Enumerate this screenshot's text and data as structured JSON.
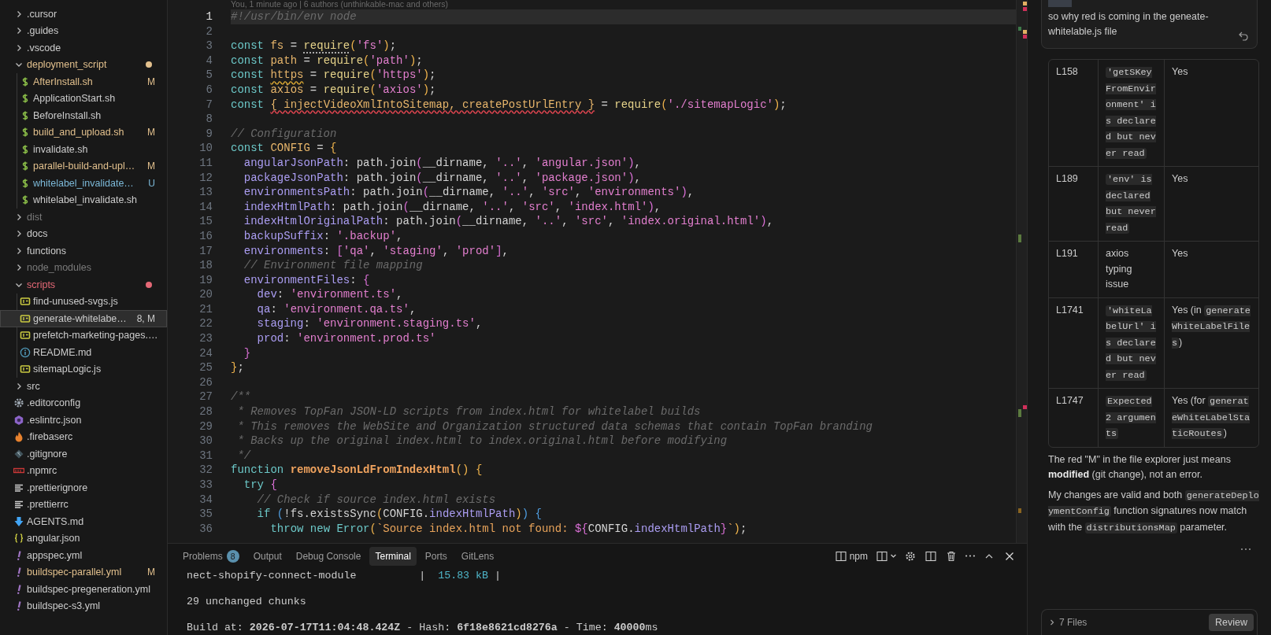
{
  "explorer": {
    "items": [
      {
        "name": ".cursor",
        "kind": "folder",
        "expanded": false,
        "dot": false,
        "color": "#cccccc",
        "selected": false
      },
      {
        "name": ".guides",
        "kind": "folder",
        "expanded": false,
        "dot": false,
        "color": "#cccccc",
        "selected": false
      },
      {
        "name": ".vscode",
        "kind": "folder",
        "expanded": false,
        "dot": false,
        "color": "#cccccc",
        "selected": false
      },
      {
        "name": "deployment_script",
        "kind": "folder",
        "expanded": true,
        "dot": true,
        "color": "#e2c08d",
        "selected": false,
        "children": [
          {
            "name": "AfterInstall.sh",
            "kind": "shell",
            "color": "#e2c08d",
            "badge": "M",
            "selected": false
          },
          {
            "name": "ApplicationStart.sh",
            "kind": "shell",
            "color": "#cccccc",
            "selected": false
          },
          {
            "name": "BeforeInstall.sh",
            "kind": "shell",
            "color": "#cccccc",
            "selected": false
          },
          {
            "name": "build_and_upload.sh",
            "kind": "shell",
            "color": "#e2c08d",
            "badge": "M",
            "selected": false
          },
          {
            "name": "invalidate.sh",
            "kind": "shell",
            "color": "#cccccc",
            "selected": false
          },
          {
            "name": "parallel-build-and-upl…",
            "kind": "shell",
            "color": "#e2c08d",
            "badge": "M",
            "selected": false
          },
          {
            "name": "whitelabel_invalidate…",
            "kind": "shell",
            "color": "#7cb9d8",
            "badge": "U",
            "selected": false
          },
          {
            "name": "whitelabel_invalidate.sh",
            "kind": "shell",
            "color": "#cccccc",
            "selected": false
          }
        ]
      },
      {
        "name": "dist",
        "kind": "folder",
        "expanded": false,
        "dot": false,
        "color": "#7a7a7a",
        "selected": false
      },
      {
        "name": "docs",
        "kind": "folder",
        "expanded": false,
        "dot": false,
        "color": "#cccccc",
        "selected": false
      },
      {
        "name": "functions",
        "kind": "folder",
        "expanded": false,
        "dot": false,
        "color": "#cccccc",
        "selected": false
      },
      {
        "name": "node_modules",
        "kind": "folder",
        "expanded": false,
        "dot": false,
        "color": "#7a7a7a",
        "selected": false
      },
      {
        "name": "scripts",
        "kind": "folder",
        "expanded": true,
        "dot": true,
        "color": "#e46876",
        "selected": false,
        "children": [
          {
            "name": "find-unused-svgs.js",
            "kind": "js",
            "color": "#cccccc",
            "selected": false
          },
          {
            "name": "generate-whitelabe…",
            "kind": "js",
            "color": "#cccccc",
            "badge": "8, M",
            "selected": true
          },
          {
            "name": "prefetch-marketing-pages.…",
            "kind": "js",
            "color": "#cccccc",
            "selected": false
          },
          {
            "name": "README.md",
            "kind": "info",
            "color": "#cccccc",
            "selected": false
          },
          {
            "name": "sitemapLogic.js",
            "kind": "js",
            "color": "#cccccc",
            "selected": false
          }
        ]
      },
      {
        "name": "src",
        "kind": "folder",
        "expanded": false,
        "dot": false,
        "color": "#cccccc",
        "selected": false
      },
      {
        "name": ".editorconfig",
        "kind": "gear",
        "color": "#cccccc",
        "selected": false
      },
      {
        "name": ".eslintrc.json",
        "kind": "hexagon",
        "color": "#cccccc",
        "selected": false
      },
      {
        "name": ".firebaserc",
        "kind": "flame",
        "color": "#cccccc",
        "selected": false
      },
      {
        "name": ".gitignore",
        "kind": "diamond",
        "color": "#cccccc",
        "selected": false
      },
      {
        "name": ".npmrc",
        "kind": "bar",
        "color": "#cccccc",
        "selected": false
      },
      {
        "name": ".prettierignore",
        "kind": "lines",
        "color": "#cccccc",
        "selected": false
      },
      {
        "name": ".prettierrc",
        "kind": "lines",
        "color": "#cccccc",
        "selected": false
      },
      {
        "name": "AGENTS.md",
        "kind": "arrow",
        "color": "#cccccc",
        "selected": false
      },
      {
        "name": "angular.json",
        "kind": "braces",
        "color": "#cccccc",
        "selected": false
      },
      {
        "name": "appspec.yml",
        "kind": "yaml",
        "color": "#cccccc",
        "selected": false
      },
      {
        "name": "buildspec-parallel.yml",
        "kind": "yaml",
        "color": "#e2c08d",
        "badge": "M",
        "selected": false
      },
      {
        "name": "buildspec-pregeneration.yml",
        "kind": "yaml",
        "color": "#cccccc",
        "selected": false
      },
      {
        "name": "buildspec-s3.yml",
        "kind": "yaml",
        "color": "#cccccc",
        "selected": false
      }
    ]
  },
  "editor": {
    "codelens": "You, 1 minute ago | 6 authors (unthinkable-mac and others)",
    "lines": [
      {
        "number": "1",
        "kind": "plain",
        "current": true,
        "text": "#!/usr/bin/env node"
      },
      {
        "number": "2",
        "current": false
      },
      {
        "number": "3",
        "kind": "hint",
        "current": false,
        "text": "const fs = require('fs');"
      },
      {
        "number": "4",
        "kind": "plain",
        "current": false,
        "text": "const path = require('path');"
      },
      {
        "number": "5",
        "kind": "warning",
        "current": false,
        "text": "const https = require('https');"
      },
      {
        "number": "6",
        "kind": "plain",
        "current": false,
        "text": "const axios = require('axios');"
      },
      {
        "number": "7",
        "kind": "error",
        "current": false,
        "text": "const { injectVideoXmlIntoSitemap, createPostUrlEntry } = require('./sitemapLogic');"
      },
      {
        "number": "8",
        "current": false
      },
      {
        "number": "9",
        "kind": "plain",
        "current": false,
        "text": "// Configuration"
      },
      {
        "number": "10",
        "kind": "plain",
        "current": false,
        "text": "const CONFIG = {"
      },
      {
        "number": "11",
        "kind": "plain",
        "current": false,
        "text": "  angularJsonPath: path.join(__dirname, '..', 'angular.json'),"
      },
      {
        "number": "12",
        "kind": "plain",
        "current": false,
        "text": "  packageJsonPath: path.join(__dirname, '..', 'package.json'),"
      },
      {
        "number": "13",
        "kind": "plain",
        "current": false,
        "text": "  environmentsPath: path.join(__dirname, '..', 'src', 'environments'),"
      },
      {
        "number": "14",
        "kind": "plain",
        "current": false,
        "text": "  indexHtmlPath: path.join(__dirname, '..', 'src', 'index.html'),"
      },
      {
        "number": "15",
        "kind": "plain",
        "current": false,
        "text": "  indexHtmlOriginalPath: path.join(__dirname, '..', 'src', 'index.original.html'),"
      },
      {
        "number": "16",
        "kind": "plain",
        "current": false,
        "text": "  backupSuffix: '.backup',"
      },
      {
        "number": "17",
        "kind": "plain",
        "current": false,
        "text": "  environments: ['qa', 'staging', 'prod'],"
      },
      {
        "number": "18",
        "kind": "plain",
        "current": false,
        "text": "  // Environment file mapping"
      },
      {
        "number": "19",
        "kind": "plain",
        "current": false,
        "text": "  environmentFiles: {"
      },
      {
        "number": "20",
        "kind": "plain",
        "current": false,
        "text": "    dev: 'environment.ts',"
      },
      {
        "number": "21",
        "kind": "plain",
        "current": false,
        "text": "    qa: 'environment.qa.ts',"
      },
      {
        "number": "22",
        "kind": "plain",
        "current": false,
        "text": "    staging: 'environment.staging.ts',"
      },
      {
        "number": "23",
        "kind": "plain",
        "current": false,
        "text": "    prod: 'environment.prod.ts'"
      },
      {
        "number": "24",
        "kind": "plain",
        "current": false,
        "text": "  }"
      },
      {
        "number": "25",
        "kind": "plain",
        "current": false,
        "text": "};"
      },
      {
        "number": "26",
        "current": false
      },
      {
        "number": "27",
        "kind": "plain",
        "current": false,
        "text": "/**"
      },
      {
        "number": "28",
        "kind": "plain",
        "current": false,
        "text": " * Removes TopFan JSON-LD scripts from index.html for whitelabel builds"
      },
      {
        "number": "29",
        "kind": "plain",
        "current": false,
        "text": " * This removes the WebSite and Organization structured data schemas that contain TopFan branding"
      },
      {
        "number": "30",
        "kind": "plain",
        "current": false,
        "text": " * Backs up the original index.html to index.original.html before modifying"
      },
      {
        "number": "31",
        "kind": "plain",
        "current": false,
        "text": " */"
      },
      {
        "number": "32",
        "kind": "plain",
        "current": false,
        "text": "function removeJsonLdFromIndexHtml() {"
      },
      {
        "number": "33",
        "kind": "plain",
        "current": false,
        "text": "  try {"
      },
      {
        "number": "34",
        "kind": "plain",
        "current": false,
        "text": "    // Check if source index.html exists"
      },
      {
        "number": "35",
        "kind": "plain",
        "current": false,
        "text": "    if (!fs.existsSync(CONFIG.indexHtmlPath)) {"
      },
      {
        "number": "36",
        "kind": "plain",
        "current": false,
        "text": "      throw new Error(`Source index.html not found: ${CONFIG.indexHtmlPath}`);"
      }
    ]
  },
  "panel": {
    "tabs": [
      {
        "label": "Problems",
        "badge": "8",
        "selected": false
      },
      {
        "label": "Output",
        "selected": false
      },
      {
        "label": "Debug Console",
        "selected": false
      },
      {
        "label": "Terminal",
        "selected": true
      },
      {
        "label": "Ports",
        "selected": false
      },
      {
        "label": "GitLens",
        "selected": false
      }
    ],
    "terminal_name": "npm",
    "terminal_lines": [
      {
        "kind": "text",
        "text": "nect-shopify-connect-module          |  15.83 kB |"
      },
      {
        "kind": "blank"
      },
      {
        "kind": "text",
        "text": "29 unchanged chunks"
      },
      {
        "kind": "blank"
      },
      {
        "kind": "text",
        "text": "Build at: **2026-07-17T11:04:48.424Z** - Hash: **6f18e8621cd8276a** - Time: **40000**ms"
      }
    ]
  },
  "chat": {
    "message": "so why red is coming in the geneate-whitelable.js file",
    "table": {
      "rows": [
        {
          "cells": [
            {
              "text": "L158",
              "code": false
            },
            {
              "text": "'getSKeyFromEnvironment' is declared but never read",
              "code": true
            },
            {
              "text": "Yes",
              "code": false
            }
          ]
        },
        {
          "cells": [
            {
              "text": "L189",
              "code": false
            },
            {
              "text": "'env' is declared but never read",
              "code": true
            },
            {
              "text": "Yes",
              "code": false
            }
          ]
        },
        {
          "cells": [
            {
              "text": "L191",
              "code": false
            },
            {
              "text": "axios typing issue",
              "code": false
            },
            {
              "text": "Yes",
              "code": false
            }
          ]
        },
        {
          "cells": [
            {
              "text": "L1741",
              "code": false
            },
            {
              "text": "'whiteLabelUrl' is declared but never read",
              "code": true
            },
            {
              "text": "Yes (in *generateWhiteLabelFiles*)",
              "code": false
            }
          ]
        },
        {
          "cells": [
            {
              "text": "L1747",
              "code": false
            },
            {
              "text": "Expected 2 arguments",
              "code": true
            },
            {
              "text": "Yes (for *generateWhiteLabelStaticRoutes*)",
              "code": false
            }
          ]
        }
      ]
    },
    "paragraphs": [
      "The red \"M\" in the file explorer just means **modified** (git change), not an error.",
      "My changes are valid and both *generateDeploymentConfig* function signatures now match with the *distributionsMap* parameter."
    ],
    "changes": {
      "label": "7 Files",
      "button": "Review"
    }
  }
}
